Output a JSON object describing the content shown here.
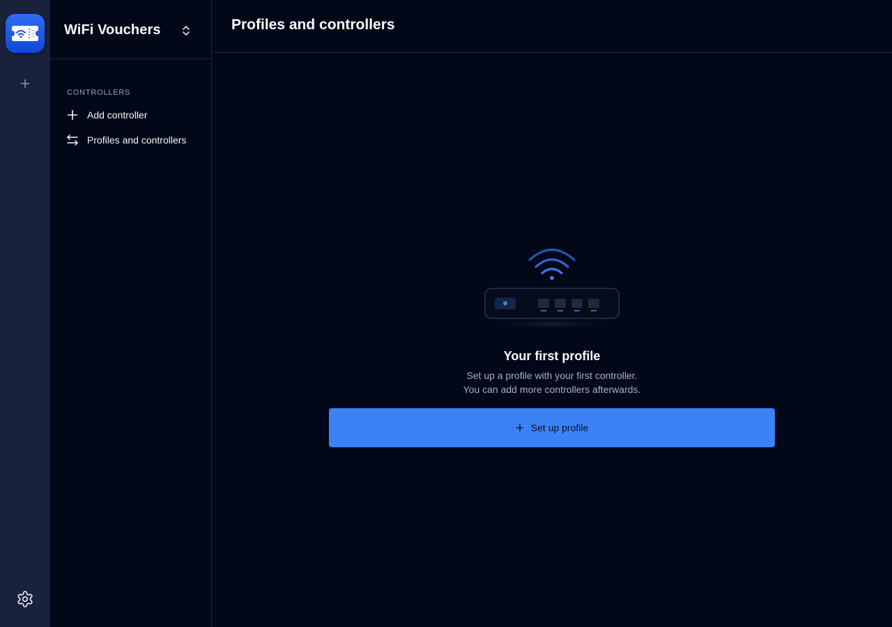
{
  "rail": {
    "app_icon": "wifi-ticket-icon",
    "add_icon": "plus-icon",
    "settings_icon": "gear-icon"
  },
  "sidebar": {
    "workspace_name": "WiFi Vouchers",
    "section_label": "CONTROLLERS",
    "items": [
      {
        "label": "Add controller",
        "icon": "plus-icon"
      },
      {
        "label": "Profiles and controllers",
        "icon": "arrows-swap-icon"
      }
    ]
  },
  "header": {
    "title": "Profiles and controllers"
  },
  "empty_state": {
    "illustration": "router-wifi-icon",
    "title": "Your first profile",
    "line1": "Set up a profile with your first controller.",
    "line2": "You can add more controllers afterwards.",
    "button_label": "Set up profile"
  },
  "colors": {
    "background": "#020817",
    "rail": "#18223b",
    "accent": "#3b82f6",
    "border": "#1e293b"
  }
}
